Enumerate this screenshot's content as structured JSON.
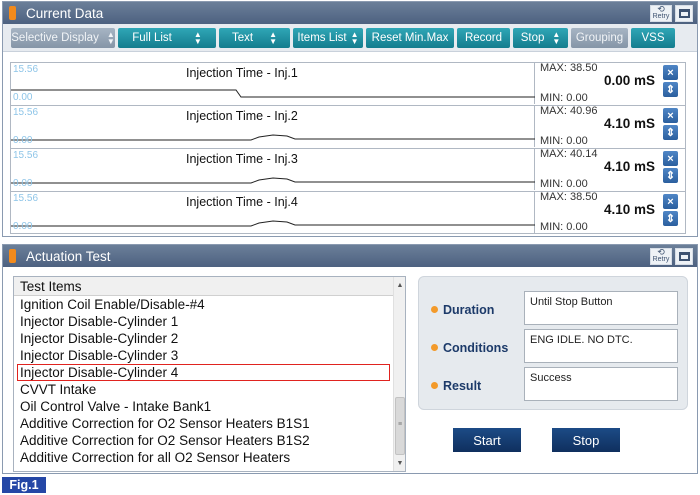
{
  "current_data": {
    "title": "Current Data",
    "retry_label": "Retry",
    "toolbar": {
      "selective_display": "Selective Display",
      "full_list": "Full List",
      "text": "Text",
      "items_list": "Items List",
      "reset_min_max": "Reset Min.Max",
      "record": "Record",
      "stop": "Stop",
      "grouping": "Grouping",
      "vss": "VSS"
    },
    "graphs": [
      {
        "title": "Injection Time - Inj.1",
        "scale_max": "15.56",
        "scale_min": "0.00",
        "max": "MAX: 38.50",
        "value": "0.00 mS",
        "min": "MIN: 0.00",
        "close": "×",
        "move": "⇕"
      },
      {
        "title": "Injection Time - Inj.2",
        "scale_max": "15.56",
        "scale_min": "0.00",
        "max": "MAX: 40.96",
        "value": "4.10 mS",
        "min": "MIN: 0.00",
        "close": "×",
        "move": "⇕"
      },
      {
        "title": "Injection Time - Inj.3",
        "scale_max": "15.56",
        "scale_min": "0.00",
        "max": "MAX: 40.14",
        "value": "4.10 mS",
        "min": "MIN: 0.00",
        "close": "×",
        "move": "⇕"
      },
      {
        "title": "Injection Time - Inj.4",
        "scale_max": "15.56",
        "scale_min": "0.00",
        "max": "MAX: 38.50",
        "value": "4.10 mS",
        "min": "MIN: 0.00",
        "close": "×",
        "move": "⇕"
      }
    ]
  },
  "actuation": {
    "title": "Actuation Test",
    "retry_label": "Retry",
    "list_header": "Test Items",
    "items": [
      "Ignition Coil Enable/Disable-#4",
      "Injector Disable-Cylinder 1",
      "Injector Disable-Cylinder 2",
      "Injector Disable-Cylinder 3",
      "Injector Disable-Cylinder 4",
      "CVVT Intake",
      "Oil Control Valve - Intake Bank1",
      "Additive Correction for O2 Sensor Heaters B1S1",
      "Additive Correction for O2 Sensor Heaters B1S2",
      "Additive Correction for all O2 Sensor Heaters"
    ],
    "selected_index": 4,
    "duration_label": "Duration",
    "duration_value": "Until Stop Button",
    "conditions_label": "Conditions",
    "conditions_value": "ENG IDLE. NO DTC.",
    "result_label": "Result",
    "result_value": "Success",
    "start_label": "Start",
    "stop_label": "Stop"
  },
  "figure_label": "Fig.1",
  "colors": {
    "header": "#5a6d89",
    "accent_teal": "#1b8a9b",
    "action_blue": "#163e73",
    "selection_red": "#e0231f",
    "figure_blue": "#2547a6"
  }
}
